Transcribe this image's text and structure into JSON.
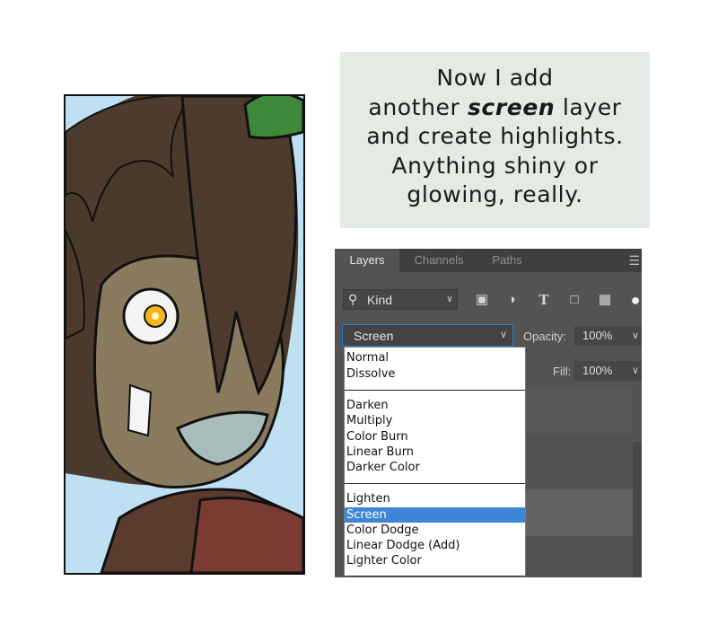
{
  "caption": {
    "line1": "Now I add",
    "line2_pre": "another ",
    "line2_emph": "screen",
    "line2_post": " layer",
    "line3": "and create highlights.",
    "line4": "Anything shiny or",
    "line5": "glowing, really."
  },
  "layers_panel": {
    "tabs": [
      "Layers",
      "Channels",
      "Paths"
    ],
    "active_tab": "Layers",
    "menu_icon": "panel-menu-icon",
    "filter": {
      "search_icon": "search-icon",
      "label": "Kind"
    },
    "filter_icons": [
      "image-icon",
      "adjustment-icon",
      "type-icon",
      "shape-icon",
      "smart-object-icon"
    ],
    "blend_mode": "Screen",
    "opacity": {
      "label": "Opacity:",
      "value": "100%"
    },
    "fill": {
      "label": "Fill:",
      "value": "100%"
    }
  },
  "blend_menu": {
    "groups": [
      [
        "Normal",
        "Dissolve"
      ],
      [
        "Darken",
        "Multiply",
        "Color Burn",
        "Linear Burn",
        "Darker Color"
      ],
      [
        "Lighten",
        "Screen",
        "Color Dodge",
        "Linear Dodge (Add)",
        "Lighter Color"
      ]
    ],
    "selected": "Screen"
  },
  "colors": {
    "accent_selection": "#3e86d5",
    "caption_bg": "#e3ebe4",
    "panel_bg": "#535353"
  }
}
